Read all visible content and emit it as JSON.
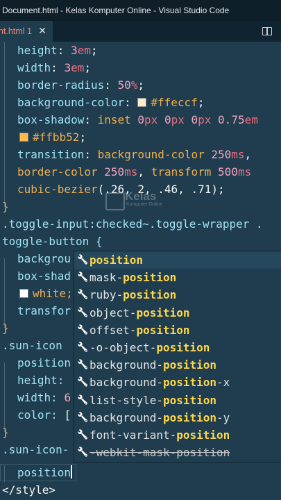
{
  "title_bar": {
    "text": "Document.html - Kelas Komputer Online - Visual Studio Code"
  },
  "tab": {
    "label": "nt.html 1",
    "close": "✕"
  },
  "watermark": {
    "main": "Kelas",
    "sub": "Komputer Online"
  },
  "code": {
    "l1": [
      "height",
      ": ",
      "3",
      "em",
      ";"
    ],
    "l2": [
      "width",
      ": ",
      "3",
      "em",
      ";"
    ],
    "l3": [
      "border-radius",
      ": ",
      "50",
      "%",
      ";"
    ],
    "l4": [
      "background-color",
      ": ",
      "#ffeccf",
      ";"
    ],
    "l5": [
      "box-shadow",
      ": ",
      "inset",
      "0",
      "px",
      "0",
      "px",
      "0",
      "px",
      "0.75",
      "em"
    ],
    "l6": [
      "#ffbb52",
      ";"
    ],
    "l7": [
      "transition",
      ": ",
      "background-color",
      "250",
      "ms",
      ","
    ],
    "l8": [
      "border-color",
      "250",
      "ms",
      ",",
      "transform",
      "500",
      "ms"
    ],
    "l9": [
      "cubic-bezier",
      "(.26, 2, .46, .71);"
    ],
    "l10": "}",
    "l11a": ".toggle-input:checked~.toggle-wrapper .",
    "l11b": "toggle-button {",
    "l12": "backgrou",
    "l13": "box-shad",
    "l14": "white;",
    "l15": "transfor",
    "l16": "}",
    "l17": ".sun-icon",
    "l18": "position",
    "l19": "height:",
    "l20a": "width: ",
    "l20b": "6",
    "l21a": "color: ",
    "l21b": "[",
    "l22": "}",
    "l23": ".sun-icon-",
    "l24": "position",
    "l25": "</style>"
  },
  "suggestions": [
    {
      "pre": "",
      "match": "position",
      "post": ""
    },
    {
      "pre": "mask-",
      "match": "position",
      "post": ""
    },
    {
      "pre": "ruby-",
      "match": "position",
      "post": ""
    },
    {
      "pre": "object-",
      "match": "position",
      "post": ""
    },
    {
      "pre": "offset-",
      "match": "position",
      "post": ""
    },
    {
      "pre": "-o-object-",
      "match": "position",
      "post": ""
    },
    {
      "pre": "background-",
      "match": "position",
      "post": ""
    },
    {
      "pre": "background-",
      "match": "position",
      "post": "-x"
    },
    {
      "pre": "list-style-",
      "match": "position",
      "post": ""
    },
    {
      "pre": "background-",
      "match": "position",
      "post": "-y"
    },
    {
      "pre": "font-variant-",
      "match": "position",
      "post": ""
    },
    {
      "pre": "-webkit-mask-position",
      "match": "",
      "post": ""
    }
  ],
  "colors": {
    "swatch1": "#ffeccf",
    "swatch2": "#ffbb52",
    "swatch3": "#ffffff"
  },
  "icons": {
    "suggestion": "wrench-icon",
    "split": "split-editor-icon",
    "more": "more-icon"
  }
}
